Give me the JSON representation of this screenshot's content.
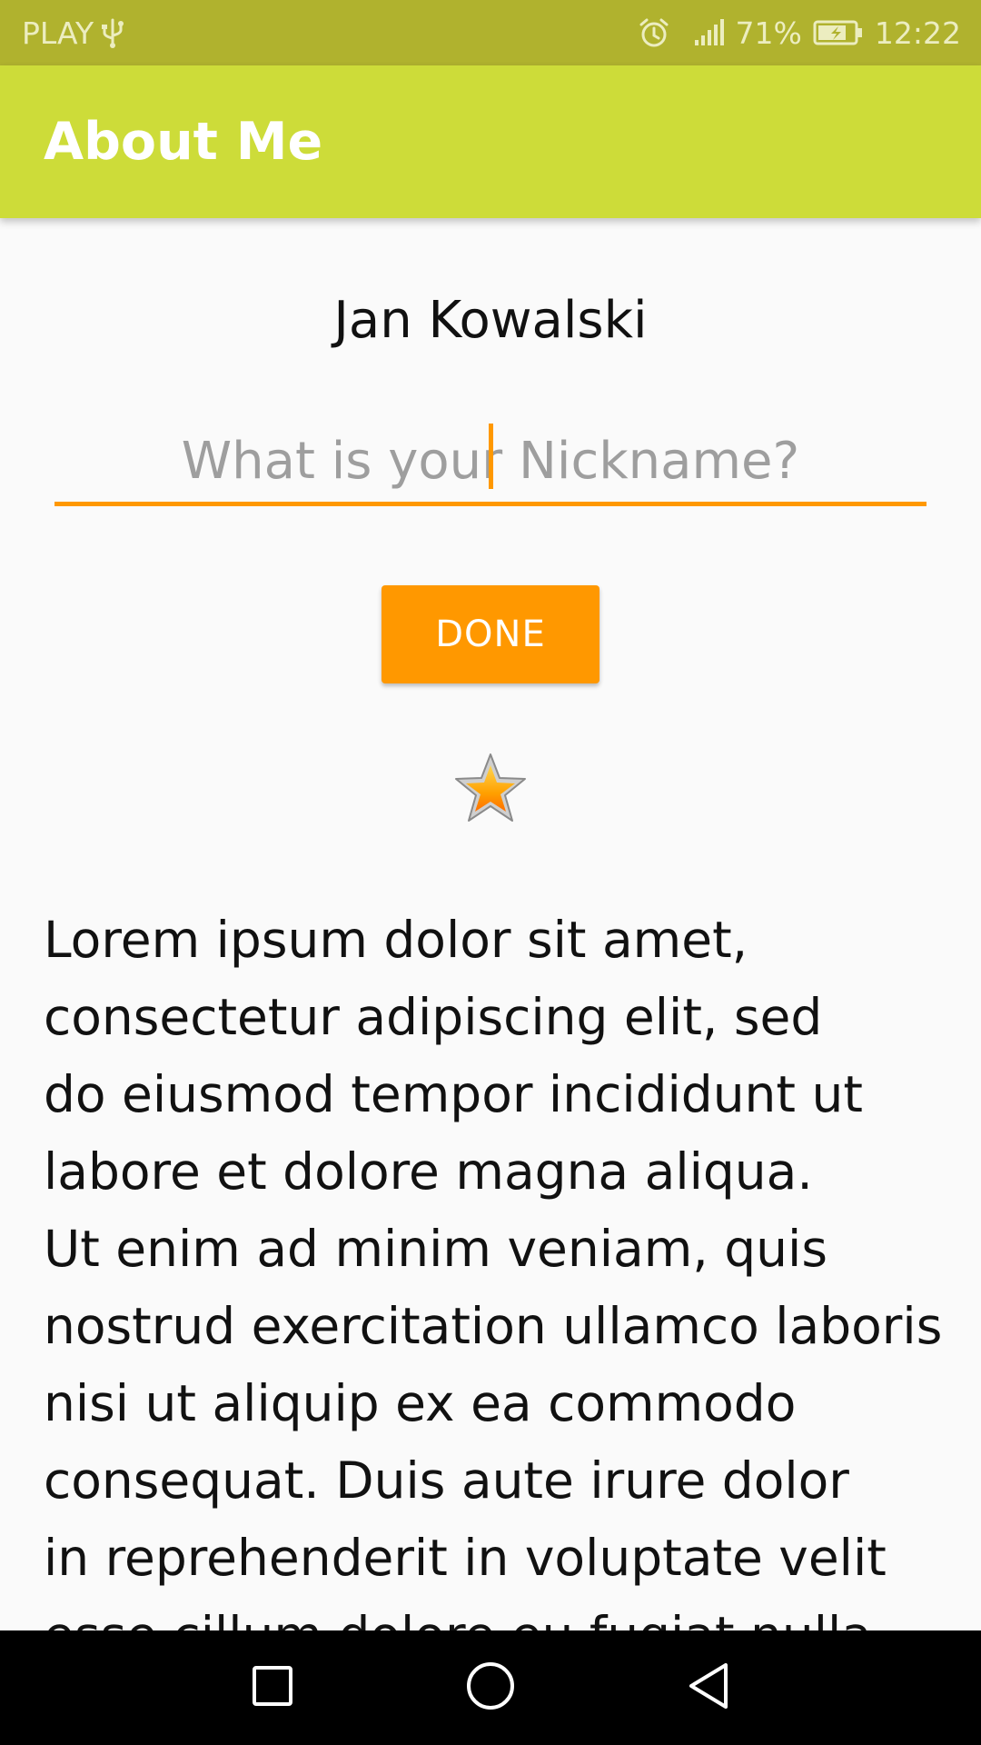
{
  "status_bar": {
    "carrier": "PLAY",
    "battery": "71%",
    "time": "12:22",
    "icons": [
      "usb-icon",
      "alarm-icon",
      "signal-icon",
      "battery-charging-icon"
    ]
  },
  "app_bar": {
    "title": "About Me",
    "color": "#cddc39"
  },
  "profile": {
    "name": "Jan Kowalski",
    "nickname_value": "",
    "nickname_placeholder": "What is your Nickname?",
    "done_label": "DONE",
    "rating_icon": "star-icon"
  },
  "bio": {
    "text": "Lorem ipsum dolor sit amet,\nconsectetur adipiscing elit, sed\ndo eiusmod tempor incididunt ut\nlabore et dolore magna aliqua.\nUt enim ad minim veniam, quis\nnostrud exercitation ullamco laboris\nnisi ut aliquip ex ea commodo\nconsequat. Duis aute irure dolor\nin reprehenderit in voluptate velit\nesse cillum dolore eu fugiat nulla"
  },
  "colors": {
    "status_bar": "#b0b22e",
    "accent": "#ff9800",
    "background": "#fafafa"
  },
  "nav_bar": {
    "buttons": [
      "recents-square-icon",
      "home-circle-icon",
      "back-triangle-icon"
    ]
  }
}
